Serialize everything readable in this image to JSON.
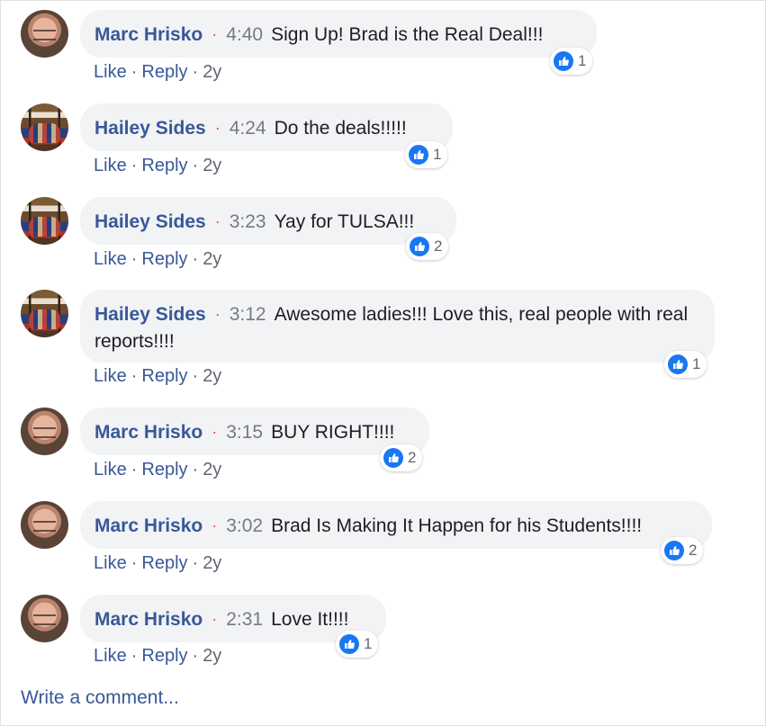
{
  "comments": [
    {
      "author": "Marc Hrisko",
      "time": "4:40",
      "text": "Sign Up! Brad is the Real Deal!!!",
      "reactions": "1"
    },
    {
      "author": "Hailey Sides",
      "time": "4:24",
      "text": "Do the deals!!!!!",
      "reactions": "1"
    },
    {
      "author": "Hailey Sides",
      "time": "3:23",
      "text": "Yay for TULSA!!!",
      "reactions": "2"
    },
    {
      "author": "Hailey Sides",
      "time": "3:12",
      "text": "Awesome ladies!!! Love this, real people with real reports!!!!",
      "reactions": "1"
    },
    {
      "author": "Marc Hrisko",
      "time": "3:15",
      "text": "BUY RIGHT!!!!",
      "reactions": "2"
    },
    {
      "author": "Marc Hrisko",
      "time": "3:02",
      "text": "Brad Is Making It Happen for his Students!!!!",
      "reactions": "2"
    },
    {
      "author": "Marc Hrisko",
      "time": "2:31",
      "text": "Love It!!!!",
      "reactions": "1"
    }
  ],
  "actions": {
    "like": "Like",
    "reply": "Reply",
    "age": "2y",
    "separator": "·"
  },
  "meta": {
    "dot": "·"
  },
  "write_comment": "Write a comment..."
}
